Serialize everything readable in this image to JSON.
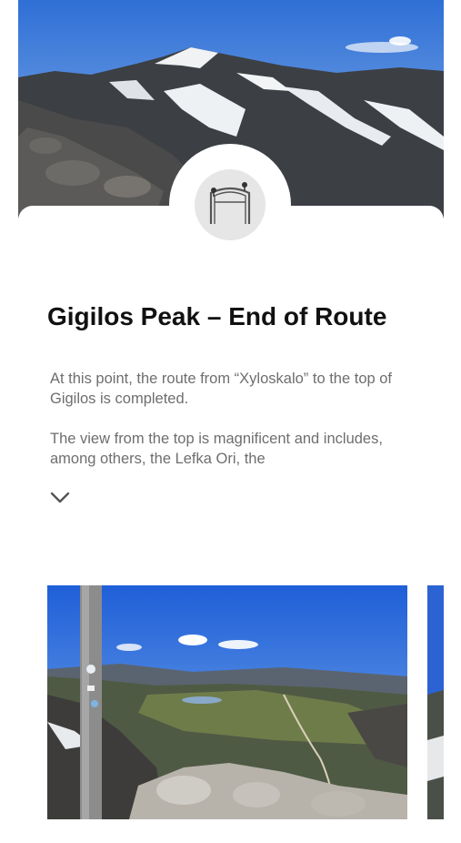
{
  "poi": {
    "title": "Gigilos Peak – End of Route",
    "description": [
      "At this point, the route from “Xyloskalo” to the top of Gigilos is completed.",
      "The view from the top is magnificent and includes, among others, the Lefka Ori, the"
    ]
  },
  "icons": {
    "route_marker": "route-end-icon",
    "expand": "chevron-down-icon"
  },
  "colors": {
    "title": "#111111",
    "body_text": "#6e6e6e",
    "icon_bg": "#e6e6e6",
    "sky": "#3f7ee0"
  }
}
